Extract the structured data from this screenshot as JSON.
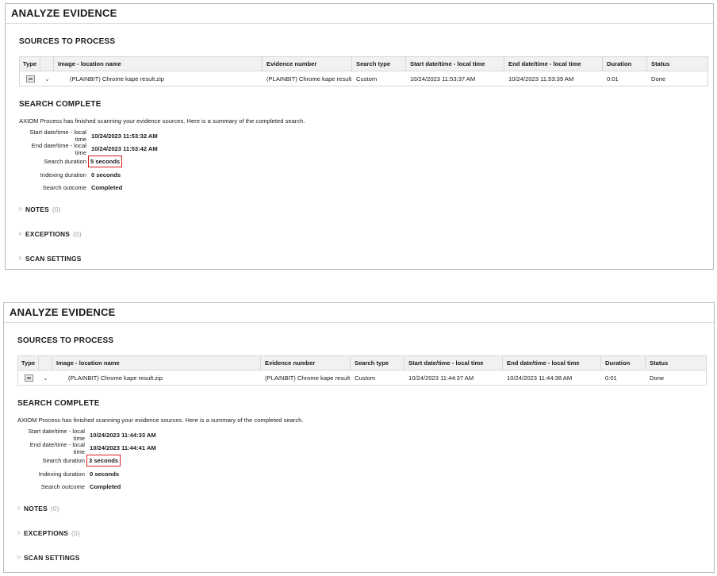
{
  "panels": [
    {
      "title": "ANALYZE EVIDENCE",
      "sources_title": "SOURCES TO PROCESS",
      "columns": [
        "Type",
        "Image - location name",
        "Evidence number",
        "Search type",
        "Start date/time - local time",
        "End date/time - local time",
        "Duration",
        "Status"
      ],
      "row": {
        "name": "(PLAINBIT) Chrome kape result.zip",
        "evidence": "(PLAINBIT) Chrome kape result.",
        "search_type": "Custom",
        "start": "10/24/2023 11:53:37 AM",
        "end": "10/24/2023 11:53:39 AM",
        "duration": "0:01",
        "status": "Done"
      },
      "complete_title": "SEARCH COMPLETE",
      "summary": "AXIOM Process has finished scanning your evidence sources. Here is a summary of the completed search.",
      "stats": [
        {
          "label": "Start date/time - local time",
          "value": "10/24/2023 11:53:32 AM"
        },
        {
          "label": "End date/time - local time",
          "value": "10/24/2023 11:53:42 AM"
        },
        {
          "label": "Search duration",
          "value": "5 seconds"
        },
        {
          "label": "Indexing duration",
          "value": "0 seconds"
        },
        {
          "label": "Search outcome",
          "value": "Completed"
        }
      ],
      "notes": {
        "label": "NOTES",
        "count": "(0)"
      },
      "exceptions": {
        "label": "EXCEPTIONS",
        "count": "(0)"
      },
      "scan_settings": {
        "label": "SCAN SETTINGS"
      }
    },
    {
      "title": "ANALYZE EVIDENCE",
      "sources_title": "SOURCES TO PROCESS",
      "columns": [
        "Type",
        "Image - location name",
        "Evidence number",
        "Search type",
        "Start date/time - local time",
        "End date/time - local time",
        "Duration",
        "Status"
      ],
      "row": {
        "name": "(PLAINBIT) Chrome kape result.zip",
        "evidence": "(PLAINBIT) Chrome kape result.",
        "search_type": "Custom",
        "start": "10/24/2023 11:44:37 AM",
        "end": "10/24/2023 11:44:38 AM",
        "duration": "0:01",
        "status": "Done"
      },
      "complete_title": "SEARCH COMPLETE",
      "summary": "AXIOM Process has finished scanning your evidence sources. Here is a summary of the completed search.",
      "stats": [
        {
          "label": "Start date/time - local time",
          "value": "10/24/2023 11:44:33 AM"
        },
        {
          "label": "End date/time - local time",
          "value": "10/24/2023 11:44:41 AM"
        },
        {
          "label": "Search duration",
          "value": "3 seconds"
        },
        {
          "label": "Indexing duration",
          "value": "0 seconds"
        },
        {
          "label": "Search outcome",
          "value": "Completed"
        }
      ],
      "notes": {
        "label": "NOTES",
        "count": "(0)"
      },
      "exceptions": {
        "label": "EXCEPTIONS",
        "count": "(0)"
      },
      "scan_settings": {
        "label": "SCAN SETTINGS"
      }
    }
  ],
  "icons": {
    "type": "evidence-image-icon",
    "expand": "chevron-down-icon",
    "caret": "caret-right-icon"
  },
  "highlight_color": "#d81e1e"
}
